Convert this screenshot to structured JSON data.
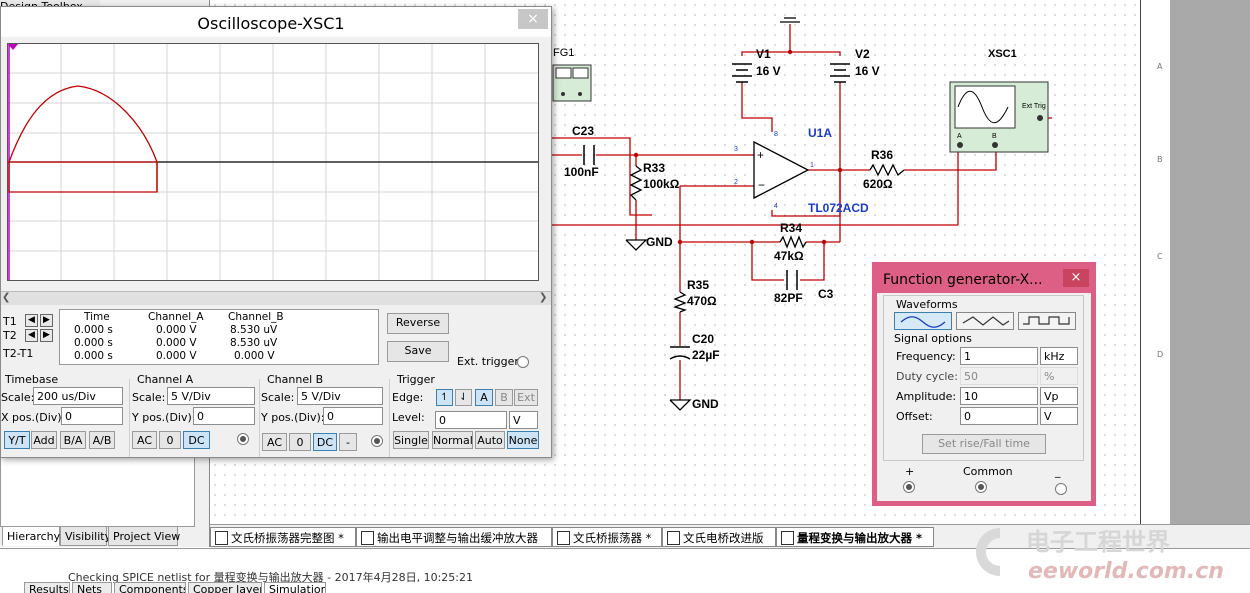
{
  "toolbox": {
    "title": "Design Toolbox",
    "tabs": [
      "Hierarchy",
      "Visibility",
      "Project View"
    ]
  },
  "scope": {
    "title": "Oscilloscope-XSC1",
    "close_glyph": "×",
    "readout": {
      "rows": [
        "T1",
        "T2",
        "T2-T1"
      ],
      "headers": [
        "Time",
        "Channel_A",
        "Channel_B"
      ],
      "values": [
        [
          "0.000 s",
          "0.000 V",
          "8.530 uV"
        ],
        [
          "0.000 s",
          "0.000 V",
          "8.530 uV"
        ],
        [
          "0.000 s",
          "0.000 V",
          "0.000 V"
        ]
      ]
    },
    "reverse_label": "Reverse",
    "save_label": "Save",
    "ext_trigger_label": "Ext. trigger",
    "timebase": {
      "title": "Timebase",
      "scale_label": "Scale:",
      "scale_value": "200 us/Div",
      "xpos_label": "X pos.(Div):",
      "xpos_value": "0",
      "modes": [
        "Y/T",
        "Add",
        "B/A",
        "A/B"
      ]
    },
    "channel_a": {
      "title": "Channel A",
      "scale_label": "Scale:",
      "scale_value": "5  V/Div",
      "ypos_label": "Y pos.(Div):",
      "ypos_value": "0",
      "coupling": [
        "AC",
        "0",
        "DC"
      ]
    },
    "channel_b": {
      "title": "Channel B",
      "scale_label": "Scale:",
      "scale_value": "5  V/Div",
      "ypos_label": "Y pos.(Div):",
      "ypos_value": "0",
      "coupling": [
        "AC",
        "0",
        "DC",
        "-"
      ]
    },
    "trigger": {
      "title": "Trigger",
      "edge_label": "Edge:",
      "edge_buttons": [
        "A",
        "B",
        "Ext"
      ],
      "level_label": "Level:",
      "level_value": "0",
      "level_unit": "V",
      "modes": [
        "Single",
        "Normal",
        "Auto",
        "None"
      ]
    }
  },
  "schematic": {
    "labels": {
      "fg1": "FG1",
      "v1": "V1",
      "v1_val": "16 V",
      "v2": "V2",
      "v2_val": "16 V",
      "xsc1": "XSC1",
      "ext_trig": "Ext Trig",
      "scope_a": "A",
      "scope_b": "B",
      "c23": "C23",
      "c23_val": "100nF",
      "r33": "R33",
      "r33_val": "100kΩ",
      "u1a": "U1A",
      "u1a_part": "TL072ACD",
      "r36": "R36",
      "r36_val": "620Ω",
      "r34": "R34",
      "r34_val": "47kΩ",
      "c3_val": "82PF",
      "c3": "C3",
      "r35": "R35",
      "r35_val": "470Ω",
      "c20": "C20",
      "c20_val": "22µF",
      "gnd1": "GND",
      "gnd2": "GND",
      "pin3": "3",
      "pin2": "2",
      "pin1": "1",
      "pin8": "8",
      "pin4": "4"
    },
    "ruler": [
      "A",
      "B",
      "C",
      "D"
    ]
  },
  "fgen": {
    "title": "Function generator-X...",
    "close_glyph": "×",
    "waveforms_label": "Waveforms",
    "signal_options_label": "Signal options",
    "fields": [
      {
        "label": "Frequency:",
        "value": "1",
        "unit": "kHz",
        "enabled": true
      },
      {
        "label": "Duty cycle:",
        "value": "50",
        "unit": "%",
        "enabled": false
      },
      {
        "label": "Amplitude:",
        "value": "10",
        "unit": "Vp",
        "enabled": true
      },
      {
        "label": "Offset:",
        "value": "0",
        "unit": "V",
        "enabled": true
      }
    ],
    "rise_fall_label": "Set rise/Fall time",
    "plus_label": "+",
    "common_label": "Common",
    "minus_label": "_"
  },
  "sheet_tabs": [
    "文氏桥振荡器完整图 *",
    "输出电平调整与输出缓冲放大器",
    "文氏桥振荡器 *",
    "文氏电桥改进版",
    "量程变换与输出放大器 *"
  ],
  "log": {
    "text": "Checking SPICE netlist for 量程变换与输出放大器 - 2017年4月28日, 10:25:21"
  },
  "bottom_tabs": [
    "Results",
    "Nets",
    "Components",
    "Copper layers",
    "Simulation"
  ],
  "watermark": {
    "cn": "电子工程世界",
    "en": "eeworld.com.cn"
  },
  "colors": {
    "wire": "#c00000",
    "trace": "#c00000",
    "cursor": "#c000c0",
    "fgen_border": "#dd5f86",
    "part_blue": "#1a3cc8"
  }
}
